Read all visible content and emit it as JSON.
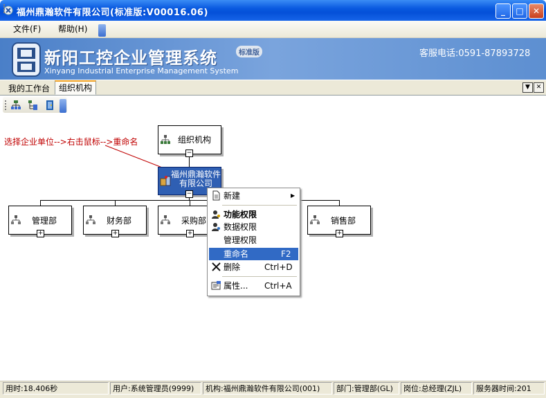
{
  "window": {
    "title": "福州鼎瀚软件有限公司(标准版:V00016.06)",
    "minimize_glyph": "_",
    "maximize_glyph": "□",
    "close_glyph": "✕"
  },
  "menu": {
    "items": [
      {
        "label": "文件(F)"
      },
      {
        "label": "帮助(H)"
      }
    ]
  },
  "banner": {
    "title": "新阳工控企业管理系统",
    "edition": "标准版",
    "subtitle": "Xinyang Industrial Enterprise Management System",
    "hotline": "客服电话:0591-87893728"
  },
  "tabs": [
    {
      "label": "我的工作台",
      "active": false
    },
    {
      "label": "组织机构",
      "active": true
    }
  ],
  "hint": "选择企业单位-->右击鼠标-->重命名",
  "org_tree": {
    "root": {
      "label": "组织机构",
      "expander": "−"
    },
    "company": {
      "label_line1": "福州鼎瀚软件",
      "label_line2": "有限公司",
      "expander": "−"
    },
    "departments": [
      {
        "label": "管理部",
        "expander": "+"
      },
      {
        "label": "财务部",
        "expander": "+"
      },
      {
        "label": "采购部",
        "expander": "+"
      },
      {
        "label": "销售部",
        "expander": "+"
      }
    ]
  },
  "context_menu": {
    "items": [
      {
        "label": "新建",
        "shortcut": "",
        "submenu_arrow": "▶"
      },
      {
        "label": "功能权限",
        "shortcut": ""
      },
      {
        "label": "数据权限",
        "shortcut": ""
      },
      {
        "label": "管理权限",
        "shortcut": ""
      },
      {
        "label": "重命名",
        "shortcut": "F2"
      },
      {
        "label": "删除",
        "shortcut": "Ctrl+D"
      },
      {
        "label": "属性...",
        "shortcut": "Ctrl+A"
      }
    ]
  },
  "status": {
    "elapsed": "用时:18.406秒",
    "user": "用户:系统管理员(9999)",
    "org": "机构:福州鼎瀚软件有限公司(001)",
    "dept": "部门:管理部(GL)",
    "post": "岗位:总经理(ZJL)",
    "server_time": "服务器时间:201"
  },
  "colors": {
    "titlebar": "#0a5ae0",
    "banner": "#5d8fd1",
    "selection": "#316ac5",
    "hint": "#c00000"
  },
  "icons": {
    "app": "app-icon",
    "org": "org-tree-icon",
    "company": "building-icon",
    "dept": "dept-tree-icon",
    "new": "new-document-icon",
    "perm": "user-key-icon",
    "delete": "delete-x-icon",
    "props": "properties-icon"
  }
}
